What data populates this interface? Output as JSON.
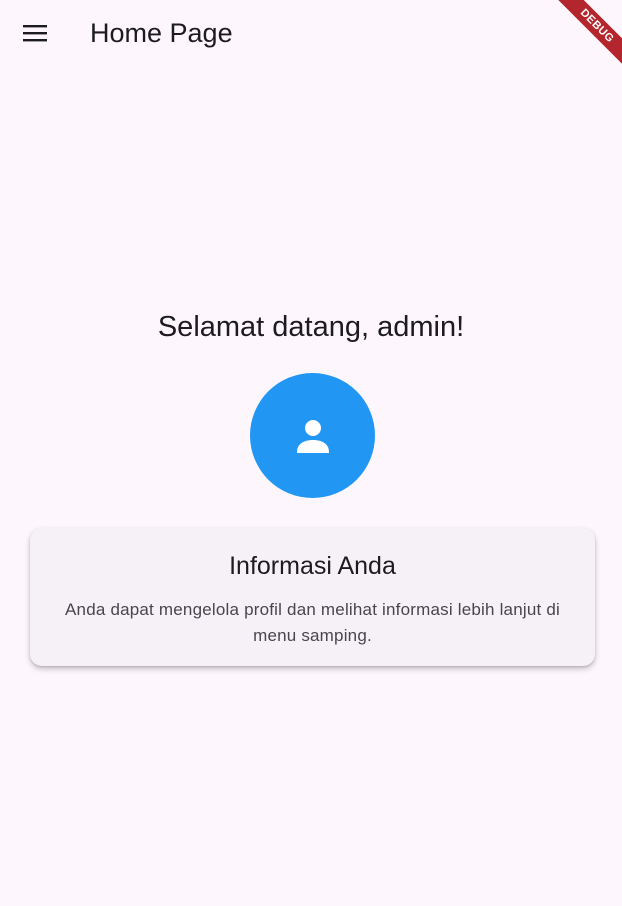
{
  "app_bar": {
    "title": "Home Page",
    "menu_icon": "menu-icon"
  },
  "debug_banner": {
    "label": "DEBUG",
    "color": "#b3262d"
  },
  "main": {
    "welcome": "Selamat datang, admin!",
    "avatar_icon": "person-icon",
    "avatar_color": "#2196f3"
  },
  "info_card": {
    "title": "Informasi Anda",
    "body": "Anda dapat mengelola profil dan melihat informasi lebih lanjut di menu samping."
  }
}
